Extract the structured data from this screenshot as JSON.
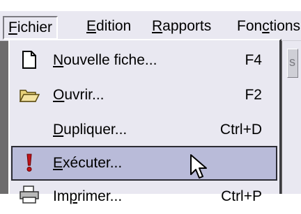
{
  "menubar": {
    "items": [
      {
        "label_u": "F",
        "label_rest": "ichier"
      },
      {
        "label_u": "E",
        "label_rest": "dition"
      },
      {
        "label_u": "R",
        "label_rest": "apports"
      },
      {
        "label_pre": "Fon",
        "label_u": "c",
        "label_rest": "tions"
      }
    ]
  },
  "menu": {
    "items": [
      {
        "icon": "new-document-icon",
        "label_u": "N",
        "label_rest": "ouvelle fiche...",
        "shortcut": "F4"
      },
      {
        "icon": "open-folder-icon",
        "label_u": "O",
        "label_rest": "uvrir...",
        "shortcut": "F2"
      },
      {
        "icon": "",
        "label_u": "D",
        "label_rest": "upliquer...",
        "shortcut": "Ctrl+D"
      },
      {
        "icon": "execute-exclamation-icon",
        "label_u": "E",
        "label_rest": "xécuter...",
        "shortcut": "",
        "highlighted": true
      },
      {
        "icon": "printer-icon",
        "label_pre": "Im",
        "label_u": "p",
        "label_rest": "rimer...",
        "shortcut": "Ctrl+P"
      }
    ]
  },
  "background": {
    "partial_glyph": "s"
  },
  "colors": {
    "menu_bg": "#e9e8f1",
    "highlight_bg": "#b9bbd9",
    "window_strip": "#6d6c6c"
  }
}
